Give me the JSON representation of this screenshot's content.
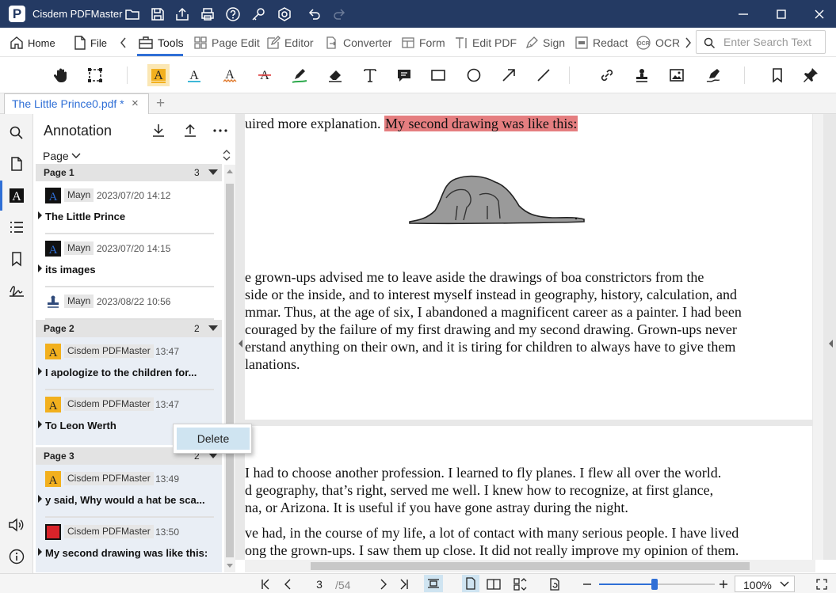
{
  "app": {
    "title": "Cisdem PDFMaster",
    "logo_letter": "P"
  },
  "menu": {
    "home": "Home",
    "file": "File",
    "tools": "Tools",
    "page_edit": "Page Edit",
    "editor": "Editor",
    "converter": "Converter",
    "form": "Form",
    "edit_pdf": "Edit PDF",
    "sign": "Sign",
    "redact": "Redact",
    "ocr": "OCR"
  },
  "search": {
    "placeholder": "Enter Search Text"
  },
  "tab": {
    "title": "The Little Prince0.pdf *",
    "close": "×",
    "add": "+"
  },
  "panel": {
    "title": "Annotation",
    "sort_label": "Page",
    "groups": [
      {
        "name": "Page 1",
        "count": "3",
        "items": [
          {
            "author": "Mayn",
            "time": "2023/07/20 14:12",
            "text": "The Little Prince",
            "icon": "text-box-icon"
          },
          {
            "author": "Mayn",
            "time": "2023/07/20 14:15",
            "text": "its images",
            "icon": "text-box-icon"
          },
          {
            "author": "Mayn",
            "time": "2023/08/22 10:56",
            "text": "",
            "icon": "stamp-icon"
          }
        ]
      },
      {
        "name": "Page 2",
        "count": "2",
        "items": [
          {
            "author": "Cisdem PDFMaster",
            "time": "13:47",
            "text": "I apologize to the children for...",
            "icon": "highlight-icon"
          },
          {
            "author": "Cisdem PDFMaster",
            "time": "13:47",
            "text": "To Leon Werth",
            "icon": "highlight-icon"
          }
        ]
      },
      {
        "name": "Page 3",
        "count": "2",
        "items": [
          {
            "author": "Cisdem PDFMaster",
            "time": "13:49",
            "text": "y said, Why would a hat be sca...",
            "icon": "highlight-icon"
          },
          {
            "author": "Cisdem PDFMaster",
            "time": "13:50",
            "text": "My second drawing was like this:",
            "icon": "highlight-red-icon"
          }
        ]
      }
    ]
  },
  "context_menu": {
    "delete": "Delete"
  },
  "document": {
    "page1_top_plain": "uired more explanation. ",
    "page1_top_highlight": "My second drawing was like this:",
    "page1_lines": [
      "e grown-ups advised me to leave aside the drawings of boa constrictors from the",
      "side or the inside, and to interest myself instead in geography, history, calculation, and",
      "mmar. Thus, at the age of six, I abandoned a magnificent career as a painter. I had been",
      "couraged by the failure of my first drawing and my second drawing. Grown-ups never",
      "erstand anything on their own, and it is tiring for children to always have to give them",
      "lanations."
    ],
    "page2_lines": [
      "I had to choose another profession. I learned to fly planes. I flew all over the world.",
      "d geography, that’s right, served me well. I knew how to recognize, at first glance,",
      "na, or Arizona. It is useful if you have gone astray during the night.",
      "ve had, in the course of my life, a lot of contact with many serious people. I have lived",
      "ong the grown-ups. I saw them up close. It did not really improve my opinion of them."
    ]
  },
  "status": {
    "current_page": "3",
    "total_pages": "/54",
    "zoom_value": "100%",
    "zoom_fraction": 0.48
  },
  "colors": {
    "titlebar": "#243a63",
    "accent": "#2f6fd6",
    "highlight_red": "#e57e80",
    "highlight_yellow": "#f2b01e"
  }
}
